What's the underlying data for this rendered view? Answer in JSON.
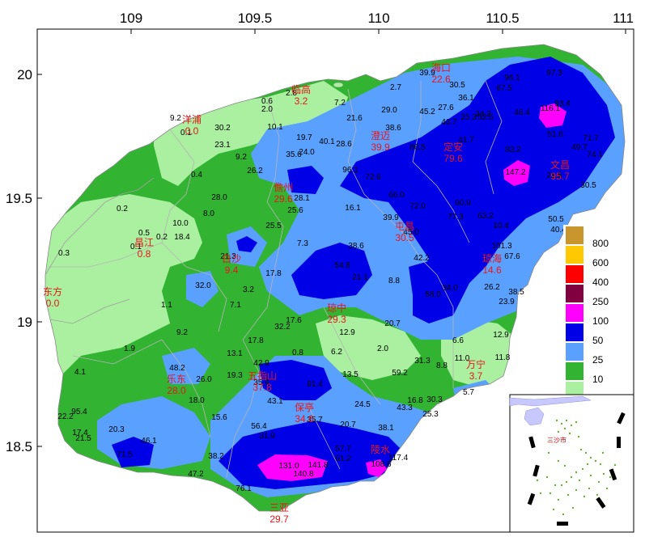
{
  "axes": {
    "x_ticks": [
      "109",
      "109.5",
      "110",
      "110.5",
      "111"
    ],
    "y_ticks": [
      "20",
      "19.5",
      "19",
      "18.5"
    ]
  },
  "legend": {
    "levels": [
      {
        "label": "800",
        "color": "#c8962d"
      },
      {
        "label": "600",
        "color": "#ffc800"
      },
      {
        "label": "400",
        "color": "#ff0000"
      },
      {
        "label": "250",
        "color": "#800040"
      },
      {
        "label": "100",
        "color": "#ff00ff"
      },
      {
        "label": "50",
        "color": "#0000e6"
      },
      {
        "label": "25",
        "color": "#5aa0ff"
      },
      {
        "label": "10",
        "color": "#32b432"
      },
      {
        "label": "1",
        "color": "#aaf0a0"
      }
    ]
  },
  "cities": [
    {
      "name": "临高",
      "value": "3.2"
    },
    {
      "name": "洋浦",
      "value": "0.0"
    },
    {
      "name": "海口",
      "value": "22.6"
    },
    {
      "name": "澄迈",
      "value": "39.9"
    },
    {
      "name": "定安",
      "value": "79.6"
    },
    {
      "name": "文昌",
      "value": "95.7"
    },
    {
      "name": "儋州",
      "value": "29.6"
    },
    {
      "name": "屯昌",
      "value": "30.5"
    },
    {
      "name": "昌江",
      "value": "0.8"
    },
    {
      "name": "白沙",
      "value": "9.4"
    },
    {
      "name": "琼海",
      "value": "14.6"
    },
    {
      "name": "东方",
      "value": "0.0"
    },
    {
      "name": "琼中",
      "value": "29.3"
    },
    {
      "name": "万宁",
      "value": "3.7"
    },
    {
      "name": "乐东",
      "value": "28.0"
    },
    {
      "name": "五指山",
      "value": "37.8"
    },
    {
      "name": "保亭",
      "value": "34.6"
    },
    {
      "name": "陵水",
      "value": ""
    },
    {
      "name": "三亚",
      "value": "29.7"
    }
  ],
  "stations": [
    "0.6",
    "2.8",
    "2.0",
    "7.2",
    "2.7",
    "39.9",
    "30.5",
    "96.1",
    "97.3",
    "9.2",
    "0.1",
    "30.2",
    "10.1",
    "21.6",
    "29.0",
    "45.2",
    "27.6",
    "36.1",
    "67.5",
    "24.2",
    "46.4",
    "93.4",
    "23.1",
    "19.7",
    "40.1",
    "28.6",
    "38.6",
    "40.7",
    "25.3",
    "52.5",
    "116.1",
    "9.2",
    "35.6",
    "24.0",
    "86.5",
    "41.7",
    "51.6",
    "71.7",
    "0.4",
    "26.2",
    "96.1",
    "72.6",
    "83.2",
    "49.7",
    "74.1",
    "28.0",
    "28.1",
    "147.2",
    "21.5",
    "30.5",
    "0.2",
    "8.0",
    "25.6",
    "16.1",
    "66.0",
    "72.0",
    "90.9",
    "77.3",
    "63.2",
    "50.5",
    "10.0",
    "25.5",
    "39.9",
    "45.0",
    "10.4",
    "40.4",
    "0.5",
    "0.2",
    "18.4",
    "38.6",
    "42.2",
    "101.3",
    "0.3",
    "0.1",
    "21.3",
    "7.3",
    "54.8",
    "67.6",
    "17.8",
    "21.1",
    "8.8",
    "58.0",
    "34.0",
    "26.2",
    "38.5",
    "32.0",
    "3.2",
    "7.1",
    "23.9",
    "1.1",
    "17.6",
    "32.2",
    "20.7",
    "12.9",
    "6.6",
    "9.2",
    "12.9",
    "1.9",
    "17.8",
    "0.8",
    "2.0",
    "11.0",
    "13.1",
    "42.9",
    "6.2",
    "31.3",
    "8.8",
    "11.8",
    "48.2",
    "19.3",
    "35.9",
    "13.5",
    "59.2",
    "4.1",
    "26.0",
    "81.4",
    "43.1",
    "24.5",
    "43.3",
    "16.8",
    "30.3",
    "5.7",
    "95.4",
    "18.0",
    "22.2",
    "15.6",
    "56.4",
    "35.7",
    "20.7",
    "38.1",
    "25.3",
    "17.4",
    "21.5",
    "20.3",
    "46.1",
    "31.9",
    "61.2",
    "57.7",
    "71.5",
    "38.2",
    "131.0",
    "141.8",
    "140.8",
    "108.6",
    "117.4",
    "47.2",
    "76.1"
  ],
  "inset": {
    "label": "三沙市"
  }
}
